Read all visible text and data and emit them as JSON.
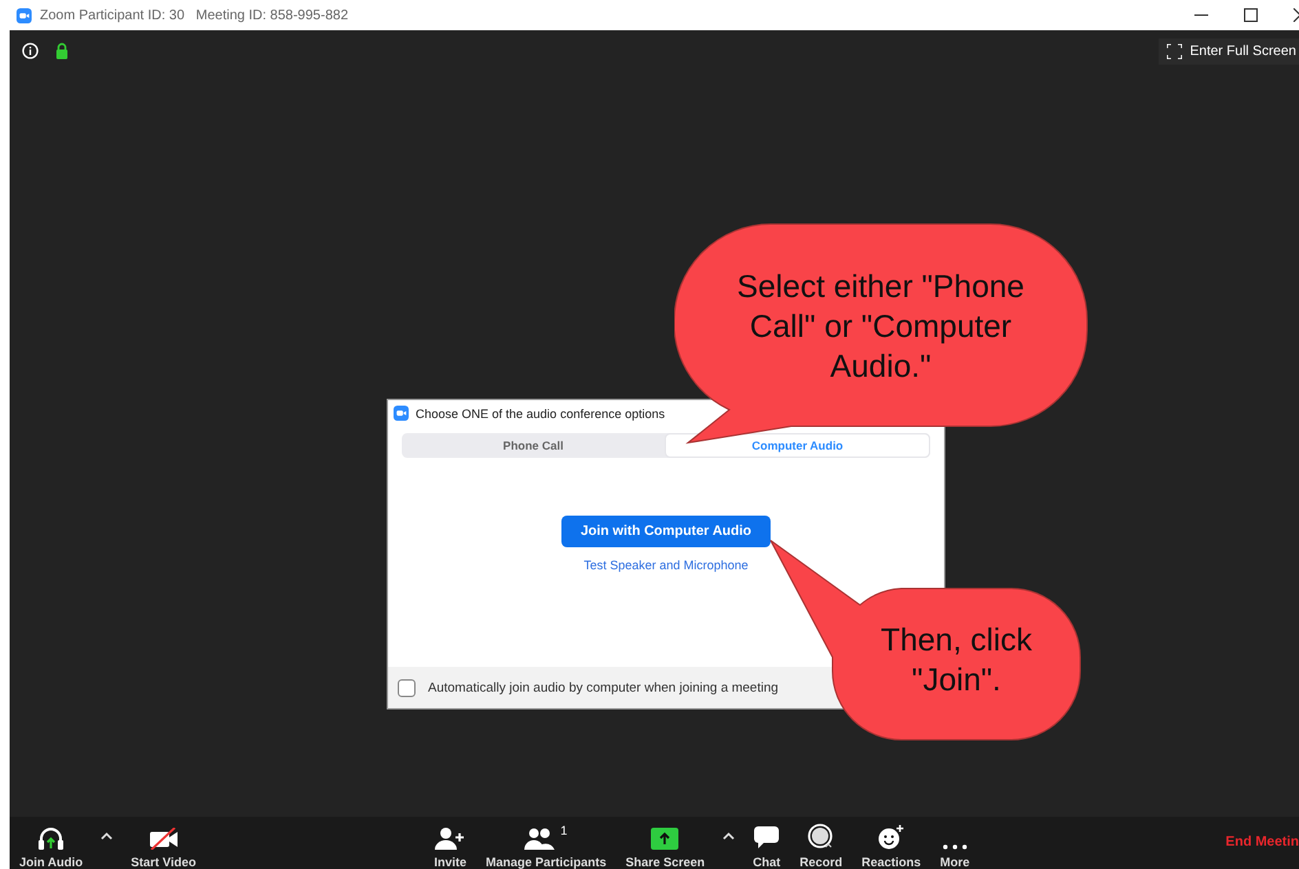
{
  "window": {
    "title": "Zoom Participant ID: 30   Meeting ID: 858-995-882"
  },
  "top_bar": {
    "full_screen": "Enter Full Screen"
  },
  "dialog": {
    "title": "Choose ONE of the audio conference options",
    "tabs": [
      {
        "label": "Phone Call",
        "selected": false
      },
      {
        "label": "Computer Audio",
        "selected": true
      }
    ],
    "join_button": "Join with Computer Audio",
    "test_link": "Test Speaker and Microphone",
    "auto_join": {
      "label": "Automatically join audio by computer when joining a meeting",
      "checked": false
    }
  },
  "callouts": [
    {
      "text": "Select either \"Phone Call\" or \"Computer Audio.\""
    },
    {
      "text": "Then, click \"Join\"."
    }
  ],
  "toolbar": {
    "items": [
      {
        "kind": "audio",
        "label": "Join Audio"
      },
      {
        "kind": "caret"
      },
      {
        "kind": "video",
        "label": "Start Video"
      },
      {
        "kind": "gap"
      },
      {
        "kind": "invite",
        "label": "Invite"
      },
      {
        "kind": "participants",
        "label": "Manage Participants",
        "badge": "1"
      },
      {
        "kind": "share",
        "label": "Share Screen"
      },
      {
        "kind": "caret"
      },
      {
        "kind": "chat",
        "label": "Chat"
      },
      {
        "kind": "record",
        "label": "Record"
      },
      {
        "kind": "reactions",
        "label": "Reactions"
      },
      {
        "kind": "more",
        "label": "More"
      },
      {
        "kind": "gap"
      }
    ],
    "end": "End Meetin"
  }
}
